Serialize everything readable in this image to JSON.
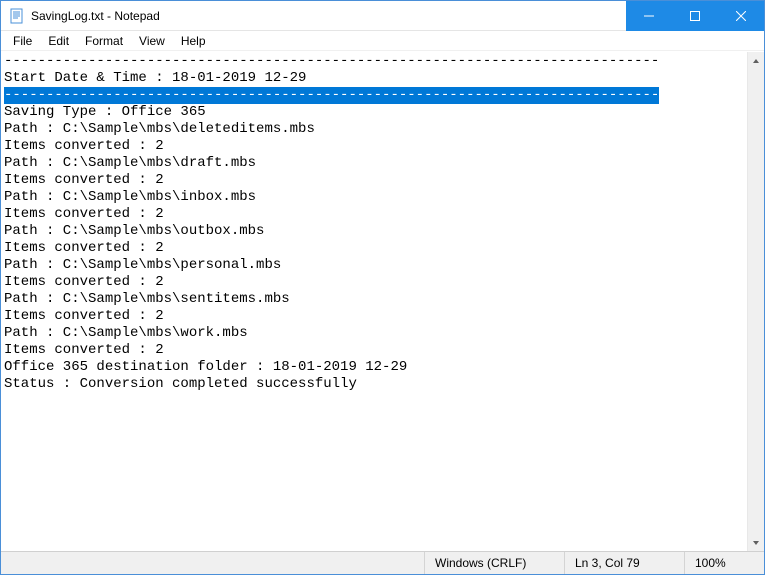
{
  "window": {
    "title": "SavingLog.txt - Notepad"
  },
  "menu": {
    "items": [
      "File",
      "Edit",
      "Format",
      "View",
      "Help"
    ]
  },
  "content": {
    "lines": [
      {
        "text": "------------------------------------------------------------------------------",
        "selected": false
      },
      {
        "text": "Start Date & Time : 18-01-2019 12-29",
        "selected": false
      },
      {
        "text": "------------------------------------------------------------------------------",
        "selected": true
      },
      {
        "text": "Saving Type : Office 365",
        "selected": false
      },
      {
        "text": "Path : C:\\Sample\\mbs\\deleteditems.mbs",
        "selected": false
      },
      {
        "text": "Items converted : 2",
        "selected": false
      },
      {
        "text": "Path : C:\\Sample\\mbs\\draft.mbs",
        "selected": false
      },
      {
        "text": "Items converted : 2",
        "selected": false
      },
      {
        "text": "Path : C:\\Sample\\mbs\\inbox.mbs",
        "selected": false
      },
      {
        "text": "Items converted : 2",
        "selected": false
      },
      {
        "text": "Path : C:\\Sample\\mbs\\outbox.mbs",
        "selected": false
      },
      {
        "text": "Items converted : 2",
        "selected": false
      },
      {
        "text": "Path : C:\\Sample\\mbs\\personal.mbs",
        "selected": false
      },
      {
        "text": "Items converted : 2",
        "selected": false
      },
      {
        "text": "Path : C:\\Sample\\mbs\\sentitems.mbs",
        "selected": false
      },
      {
        "text": "Items converted : 2",
        "selected": false
      },
      {
        "text": "Path : C:\\Sample\\mbs\\work.mbs",
        "selected": false
      },
      {
        "text": "Items converted : 2",
        "selected": false
      },
      {
        "text": "Office 365 destination folder : 18-01-2019 12-29",
        "selected": false
      },
      {
        "text": "Status : Conversion completed successfully",
        "selected": false
      }
    ]
  },
  "statusbar": {
    "encoding": "Windows (CRLF)",
    "position": "Ln 3, Col 79",
    "zoom": "100%"
  }
}
